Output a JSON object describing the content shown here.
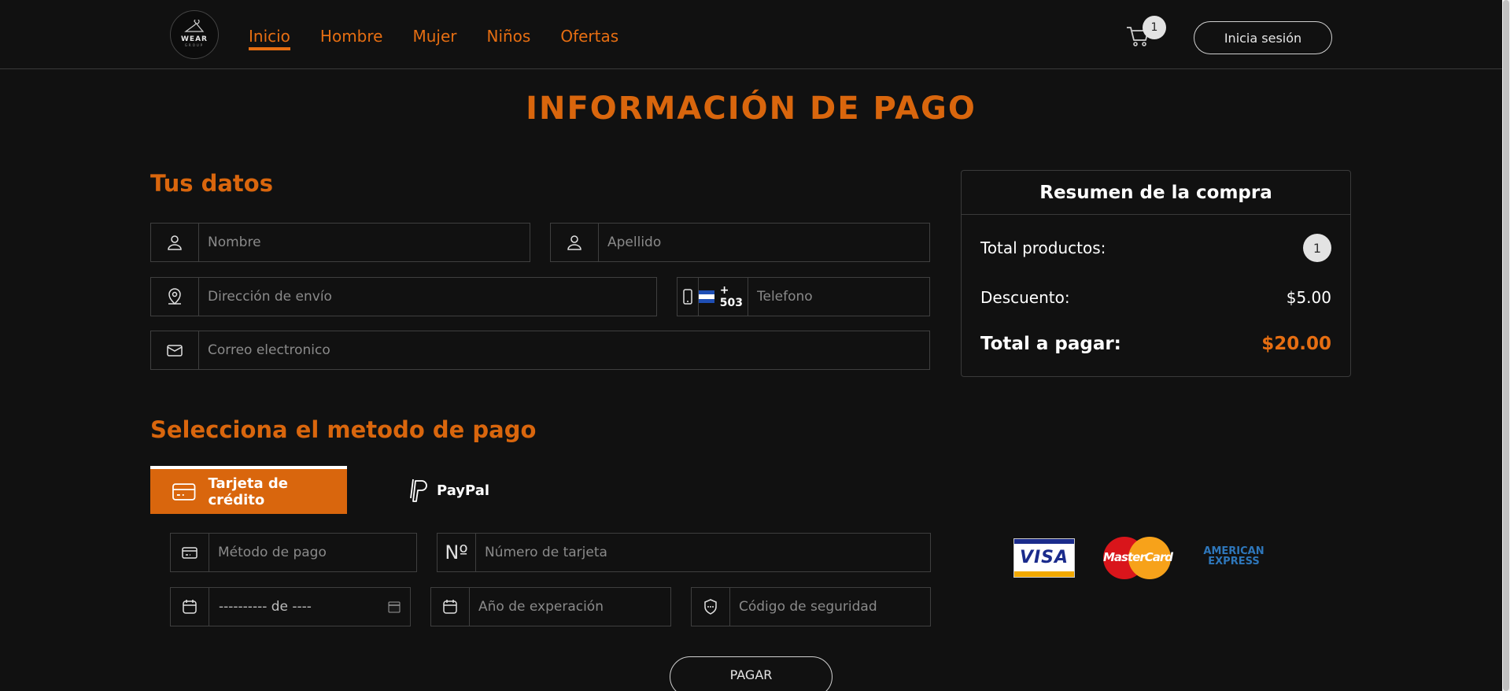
{
  "nav": {
    "logo_text": "WEAR",
    "logo_sub": "GROUP",
    "links": [
      {
        "label": "Inicio",
        "active": true
      },
      {
        "label": "Hombre"
      },
      {
        "label": "Mujer"
      },
      {
        "label": "Niños"
      },
      {
        "label": "Ofertas"
      }
    ],
    "cart_count": "1",
    "login_label": "Inicia sesión"
  },
  "page_title": "INFORMACIÓN DE PAGO",
  "personal": {
    "title": "Tus datos",
    "first_name_placeholder": "Nombre",
    "last_name_placeholder": "Apellido",
    "address_placeholder": "Dirección de envío",
    "phone_prefix": "+ 503",
    "phone_placeholder": "Telefono",
    "email_placeholder": "Correo electronico"
  },
  "summary": {
    "title": "Resumen de la compra",
    "products_label": "Total productos:",
    "products_count": "1",
    "discount_label": "Descuento:",
    "discount_value": "$5.00",
    "total_label": "Total a pagar:",
    "total_value": "$20.00"
  },
  "payment": {
    "title": "Selecciona el metodo de pago",
    "tab_card_label": "Tarjeta de crédito",
    "tab_paypal_label": "PayPal",
    "method_placeholder": "Método de pago",
    "card_number_prefix": "Nº",
    "card_number_placeholder": "Número de tarjeta",
    "month_value": "---------- de ----",
    "year_placeholder": "Año de experación",
    "cvv_placeholder": "Código de seguridad",
    "card_brands": {
      "visa": "VISA",
      "mastercard": "MasterCard",
      "amex_line1": "AMERICAN",
      "amex_line2": "EXPRESS"
    },
    "pay_button": "PAGAR"
  },
  "colors": {
    "accent": "#d9660d",
    "background": "#111111",
    "flag_blue": "#1f4fb5"
  }
}
